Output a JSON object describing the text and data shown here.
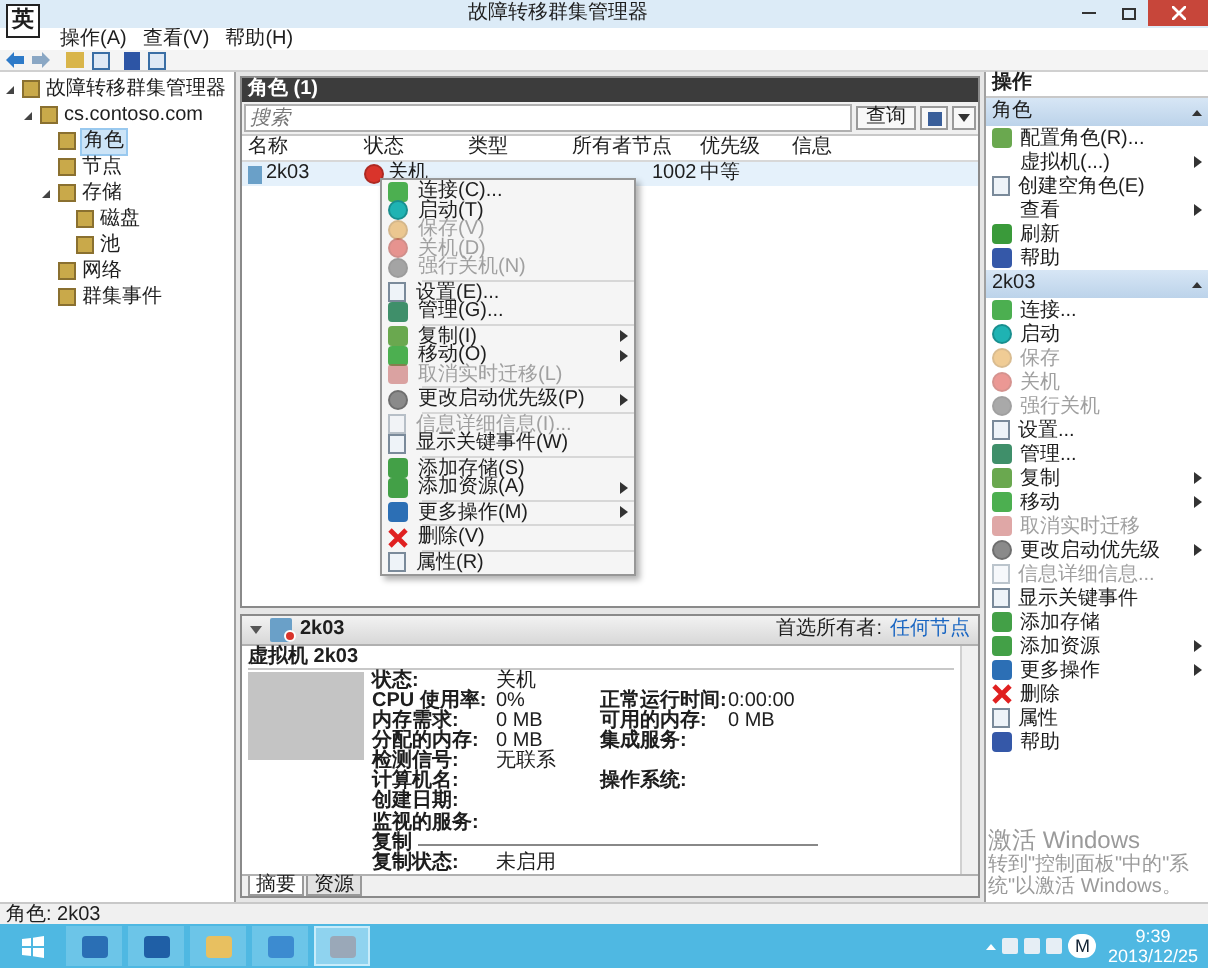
{
  "ime_indicator": "英",
  "window": {
    "title": "故障转移群集管理器"
  },
  "menu_bar": [
    "操作(A)",
    "查看(V)",
    "帮助(H)"
  ],
  "tree": [
    {
      "label": "故障转移群集管理器",
      "selected": false,
      "expanded": true,
      "children": [
        {
          "label": "cs.contoso.com",
          "selected": false,
          "expanded": true,
          "children": [
            {
              "label": "角色",
              "selected": true
            },
            {
              "label": "节点",
              "selected": false
            },
            {
              "label": "存储",
              "selected": false,
              "expanded": true,
              "children": [
                {
                  "label": "磁盘",
                  "selected": false
                },
                {
                  "label": "池",
                  "selected": false
                }
              ]
            },
            {
              "label": "网络",
              "selected": false
            },
            {
              "label": "群集事件",
              "selected": false
            }
          ]
        }
      ]
    }
  ],
  "roles_panel": {
    "title": "角色 (1)",
    "search": {
      "placeholder": "搜索"
    },
    "query_button": "查询",
    "columns": [
      "名称",
      "状态",
      "类型",
      "所有者节点",
      "优先级",
      "信息"
    ],
    "rows": [
      {
        "name": "2k03",
        "status": "关机",
        "owner": "1002",
        "priority": "中等",
        "selected": true
      }
    ]
  },
  "context_menu": [
    {
      "kind": "item",
      "label": "连接(C)...",
      "disabled": false,
      "submenu": false
    },
    {
      "kind": "item",
      "label": "启动(T)",
      "disabled": false,
      "submenu": false
    },
    {
      "kind": "item",
      "label": "保存(V)",
      "disabled": true,
      "submenu": false
    },
    {
      "kind": "item",
      "label": "关机(D)",
      "disabled": true,
      "submenu": false
    },
    {
      "kind": "item",
      "label": "强行关机(N)",
      "disabled": true,
      "submenu": false
    },
    {
      "kind": "separator"
    },
    {
      "kind": "item",
      "label": "设置(E)...",
      "disabled": false,
      "submenu": false
    },
    {
      "kind": "item",
      "label": "管理(G)...",
      "disabled": false,
      "submenu": false
    },
    {
      "kind": "separator"
    },
    {
      "kind": "item",
      "label": "复制(I)",
      "disabled": false,
      "submenu": true
    },
    {
      "kind": "item",
      "label": "移动(O)",
      "disabled": false,
      "submenu": true
    },
    {
      "kind": "item",
      "label": "取消实时迁移(L)",
      "disabled": true,
      "submenu": false
    },
    {
      "kind": "separator"
    },
    {
      "kind": "item",
      "label": "更改启动优先级(P)",
      "disabled": false,
      "submenu": true
    },
    {
      "kind": "separator"
    },
    {
      "kind": "item",
      "label": "信息详细信息(I)...",
      "disabled": true,
      "submenu": false
    },
    {
      "kind": "item",
      "label": "显示关键事件(W)",
      "disabled": false,
      "submenu": false
    },
    {
      "kind": "separator"
    },
    {
      "kind": "item",
      "label": "添加存储(S)",
      "disabled": false,
      "submenu": false
    },
    {
      "kind": "item",
      "label": "添加资源(A)",
      "disabled": false,
      "submenu": true
    },
    {
      "kind": "separator"
    },
    {
      "kind": "item",
      "label": "更多操作(M)",
      "disabled": false,
      "submenu": true
    },
    {
      "kind": "separator"
    },
    {
      "kind": "item",
      "label": "删除(V)",
      "disabled": false,
      "submenu": false
    },
    {
      "kind": "separator"
    },
    {
      "kind": "item",
      "label": "属性(R)",
      "disabled": false,
      "submenu": false
    }
  ],
  "details": {
    "name": "2k03",
    "preferred_owner_label": "首选所有者:",
    "preferred_owner_link": "任何节点",
    "heading": "虚拟机 2k03",
    "rows": [
      {
        "cells": [
          {
            "label": "状态:",
            "value": "关机"
          }
        ]
      },
      {
        "cells": [
          {
            "label": "CPU 使用率:",
            "value": "0%"
          },
          {
            "label": "正常运行时间:",
            "value": "0:00:00"
          }
        ]
      },
      {
        "cells": [
          {
            "label": "内存需求:",
            "value": "0 MB"
          },
          {
            "label": "可用的内存:",
            "value": "0 MB"
          }
        ]
      },
      {
        "cells": [
          {
            "label": "分配的内存:",
            "value": "0 MB"
          },
          {
            "label": "集成服务:"
          }
        ]
      },
      {
        "cells": [
          {
            "label": "检测信号:",
            "value": "无联系"
          }
        ]
      },
      {
        "cells": [
          {
            "label": "计算机名:"
          },
          {
            "label": "操作系统:"
          }
        ]
      },
      {
        "cells": [
          {
            "label": "创建日期:"
          }
        ]
      },
      {
        "cells": [
          {
            "label": "监视的服务:"
          }
        ]
      }
    ],
    "replication_title": "复制",
    "replication": {
      "label": "复制状态:",
      "value": "未启用"
    },
    "tabs": [
      {
        "label": "摘要",
        "selected": true
      },
      {
        "label": "资源",
        "selected": false
      }
    ]
  },
  "actions": {
    "title": "操作",
    "sections": [
      {
        "title": "角色",
        "items": [
          {
            "label": "配置角色(R)...",
            "submenu": false,
            "disabled": false
          },
          {
            "label": "虚拟机(...)",
            "submenu": true,
            "disabled": false
          },
          {
            "label": "创建空角色(E)",
            "submenu": false,
            "disabled": false
          },
          {
            "label": "查看",
            "submenu": true,
            "disabled": false
          },
          {
            "label": "刷新",
            "submenu": false,
            "disabled": false
          },
          {
            "label": "帮助",
            "submenu": false,
            "disabled": false
          }
        ]
      },
      {
        "title": "2k03",
        "items": [
          {
            "label": "连接...",
            "submenu": false,
            "disabled": false
          },
          {
            "label": "启动",
            "submenu": false,
            "disabled": false
          },
          {
            "label": "保存",
            "submenu": false,
            "disabled": true
          },
          {
            "label": "关机",
            "submenu": false,
            "disabled": true
          },
          {
            "label": "强行关机",
            "submenu": false,
            "disabled": true
          },
          {
            "label": "设置...",
            "submenu": false,
            "disabled": false
          },
          {
            "label": "管理...",
            "submenu": false,
            "disabled": false
          },
          {
            "label": "复制",
            "submenu": true,
            "disabled": false
          },
          {
            "label": "移动",
            "submenu": true,
            "disabled": false
          },
          {
            "label": "取消实时迁移",
            "submenu": false,
            "disabled": true
          },
          {
            "label": "更改启动优先级",
            "submenu": true,
            "disabled": false
          },
          {
            "label": "信息详细信息...",
            "submenu": false,
            "disabled": true
          },
          {
            "label": "显示关键事件",
            "submenu": false,
            "disabled": false
          },
          {
            "label": "添加存储",
            "submenu": false,
            "disabled": false
          },
          {
            "label": "添加资源",
            "submenu": true,
            "disabled": false
          },
          {
            "label": "更多操作",
            "submenu": true,
            "disabled": false
          },
          {
            "label": "删除",
            "submenu": false,
            "disabled": false
          },
          {
            "label": "属性",
            "submenu": false,
            "disabled": false
          },
          {
            "label": "帮助",
            "submenu": false,
            "disabled": false
          }
        ]
      }
    ]
  },
  "activation_notice": {
    "title": "激活 Windows",
    "text": "转到\"控制面板\"中的\"系统\"以激活 Windows。"
  },
  "status_bar": "角色: 2k03",
  "taskbar": {
    "apps": [
      {
        "selected": false
      },
      {
        "selected": false
      },
      {
        "selected": false
      },
      {
        "selected": false
      },
      {
        "selected": true
      }
    ],
    "ime": "M",
    "time": "9:39",
    "date": "2013/12/25"
  }
}
